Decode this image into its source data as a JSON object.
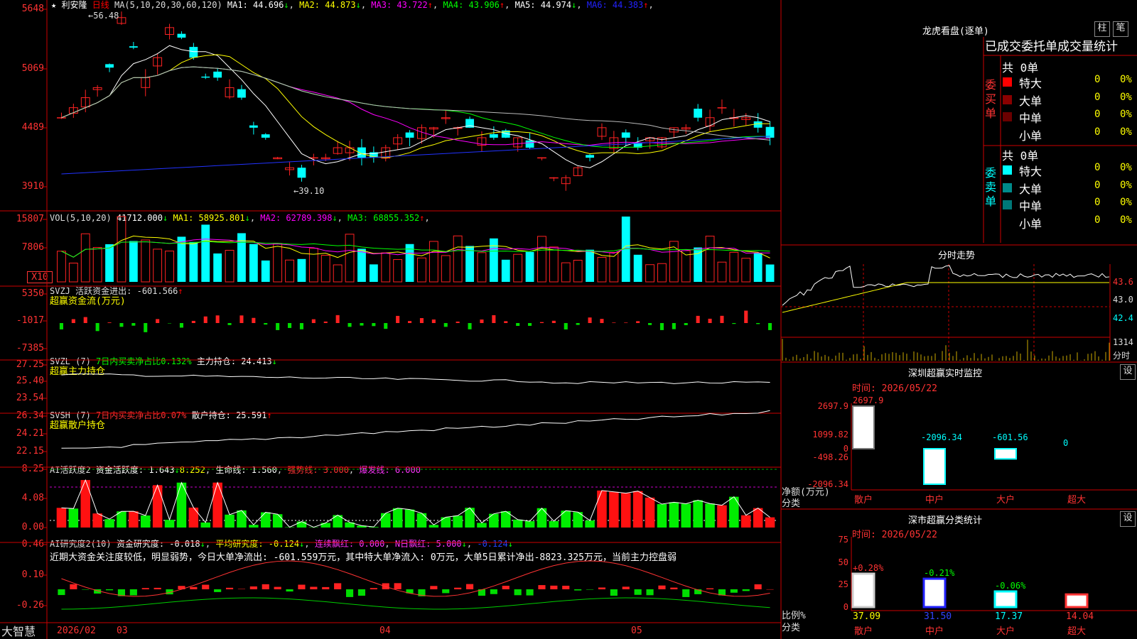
{
  "app": {
    "brand": "大智慧",
    "star": "★",
    "stock_name": "利安隆",
    "period": "日线"
  },
  "main_chart": {
    "ma_label": "MA(5,10,20,30,60,120)",
    "ma": [
      {
        "label": "MA1: 44.696",
        "arrow": "↓",
        "color": "#ffffff"
      },
      {
        "label": "MA2: 44.873",
        "arrow": "↓",
        "color": "#ffff00"
      },
      {
        "label": "MA3: 43.722",
        "arrow": "↑",
        "color": "#ff00ff"
      },
      {
        "label": "MA4: 43.906",
        "arrow": "↑",
        "color": "#00ff00"
      },
      {
        "label": "MA5: 44.974",
        "arrow": "↓",
        "color": "#ffffff"
      },
      {
        "label": "MA6: 44.383",
        "arrow": "↑",
        "color": "#2222ff"
      }
    ],
    "y_ticks": [
      "5648",
      "5069",
      "4489",
      "3910"
    ],
    "high_label": "56.48",
    "low_label": "39.10"
  },
  "vol_panel": {
    "title": "VOL(5,10,20)",
    "value": "41712.000",
    "value_arrow": "↓",
    "ma": [
      {
        "label": "MA1: 58925.801",
        "arrow": "↓",
        "color": "#ffff00"
      },
      {
        "label": "MA2: 62789.398",
        "arrow": "↓",
        "color": "#ff00ff"
      },
      {
        "label": "MA3: 68855.352",
        "arrow": "↑",
        "color": "#00ff00"
      }
    ],
    "y_ticks": [
      "15807",
      "7806"
    ],
    "unit": "X10"
  },
  "svzj_panel": {
    "title": "SVZJ",
    "label": "活跃资金进出: -601.566",
    "arrow": "↑",
    "subtitle": "超赢资金流(万元)",
    "y_ticks": [
      "5350",
      "-1017",
      "-7385"
    ]
  },
  "svzl_panel": {
    "title": "SVZL (7)",
    "ratio": "7日内买卖净占比0.132%",
    "hold": "主力持仓: 24.413",
    "arrow": "↓",
    "subtitle": "超赢主力持仓",
    "y_ticks": [
      "27.25",
      "25.40",
      "23.54"
    ]
  },
  "svsh_panel": {
    "title": "SVSH (7)",
    "ratio": "7日内买卖净占比0.07%",
    "hold": "散户持仓: 25.591",
    "arrow": "↑",
    "subtitle": "超赢散户持仓",
    "y_ticks": [
      "26.34",
      "24.21",
      "22.15"
    ]
  },
  "ai_active_panel": {
    "title": "AI活跃度2",
    "active": "资金活跃度: 1.643",
    "active_arrow": "↓",
    "v2": "8.252",
    "life": "生命线: 1.560",
    "strong": "强势线: 3.000",
    "burst": "爆发线: 6.000",
    "y_ticks": [
      "8.25",
      "4.08",
      "0.00"
    ]
  },
  "ai_research_panel": {
    "title": "AI研究度2(10)",
    "research": "资金研究度: -0.018",
    "research_arrow": "↓",
    "avg": "平均研究度: -0.124",
    "avg_arrow": "↓",
    "red": "连续飘红: 0.000",
    "nred": "N日飘红: 5.000",
    "nred_arrow": "↓",
    "last": "-0.124",
    "last_arrow": "↓",
    "comment": "近期大资金关注度较低，明显弱势，今日大单净流出: -601.559万元，其中特大单净流入: 0万元，大单5日累计净出-8823.325万元，当前主力控盘弱",
    "y_ticks": [
      "0.46",
      "0.10",
      "-0.26"
    ]
  },
  "date_axis": {
    "year_label": "2026/02",
    "months": [
      "03",
      "04",
      "05"
    ]
  },
  "right_panel": {
    "lhb_title": "龙虎看盘(逐单)",
    "btn_zhu": "柱",
    "btn_bi": "笔",
    "stats_title": "已成交委托单成交量统计",
    "buy": {
      "side_label": "委买单",
      "total": "共 0单",
      "rows": [
        {
          "name": "特大",
          "count": "0",
          "pct": "0%",
          "color": "#ff0000"
        },
        {
          "name": "大单",
          "count": "0",
          "pct": "0%",
          "color": "#8b0000"
        },
        {
          "name": "中单",
          "count": "0",
          "pct": "0%",
          "color": "#6b0000"
        },
        {
          "name": "小单",
          "count": "0",
          "pct": "0%",
          "color": ""
        }
      ]
    },
    "sell": {
      "side_label": "委卖单",
      "total": "共 0单",
      "rows": [
        {
          "name": "特大",
          "count": "0",
          "pct": "0%",
          "color": "#00ffff"
        },
        {
          "name": "大单",
          "count": "0",
          "pct": "0%",
          "color": "#008b8b"
        },
        {
          "name": "中单",
          "count": "0",
          "pct": "0%",
          "color": "#007777"
        },
        {
          "name": "小单",
          "count": "0",
          "pct": "0%",
          "color": ""
        }
      ]
    },
    "intraday": {
      "title": "分时走势",
      "prices": [
        "43.6",
        "43.0",
        "42.4"
      ],
      "vol": "1314",
      "vol_unit": "分时"
    },
    "sz_monitor": {
      "title": "深圳超赢实时监控",
      "set": "设",
      "time": "时间: 2026/05/22",
      "y_ticks": [
        "2697.9",
        "1099.82",
        "0",
        "-498.26",
        "-2096.34"
      ],
      "ylabel": "净额(万元)",
      "xlabel": "分类",
      "cats": [
        "散户",
        "中户",
        "大户",
        "超大"
      ],
      "values": [
        2697.9,
        -2096.34,
        -601.56,
        0
      ],
      "value_labels": [
        "2697.9",
        "-2096.34",
        "-601.56",
        "0"
      ]
    },
    "sz_class": {
      "title": "深市超赢分类统计",
      "set": "设",
      "time": "时间: 2026/05/22",
      "y_ticks": [
        "75",
        "50",
        "25",
        "0"
      ],
      "ylabel": "比例%",
      "xlabel": "分类",
      "cats": [
        "散户",
        "中户",
        "大户",
        "超大"
      ],
      "values": [
        37.09,
        31.5,
        17.37,
        14.04
      ],
      "value_labels": [
        "37.09",
        "31.50",
        "17.37",
        "14.04"
      ],
      "changes": [
        "+0.28%",
        "-0.21%",
        "-0.06%",
        ""
      ]
    }
  },
  "chart_data": [
    {
      "type": "bar",
      "title": "深圳超赢实时监控",
      "ylabel": "净额(万元)",
      "categories": [
        "散户",
        "中户",
        "大户",
        "超大"
      ],
      "values": [
        2697.9,
        -2096.34,
        -601.56,
        0
      ],
      "ylim": [
        -2096.34,
        2697.9
      ]
    },
    {
      "type": "bar",
      "title": "深市超赢分类统计",
      "ylabel": "比例%",
      "categories": [
        "散户",
        "中户",
        "大户",
        "超大"
      ],
      "values": [
        37.09,
        31.5,
        17.37,
        14.04
      ],
      "ylim": [
        0,
        75
      ]
    }
  ]
}
